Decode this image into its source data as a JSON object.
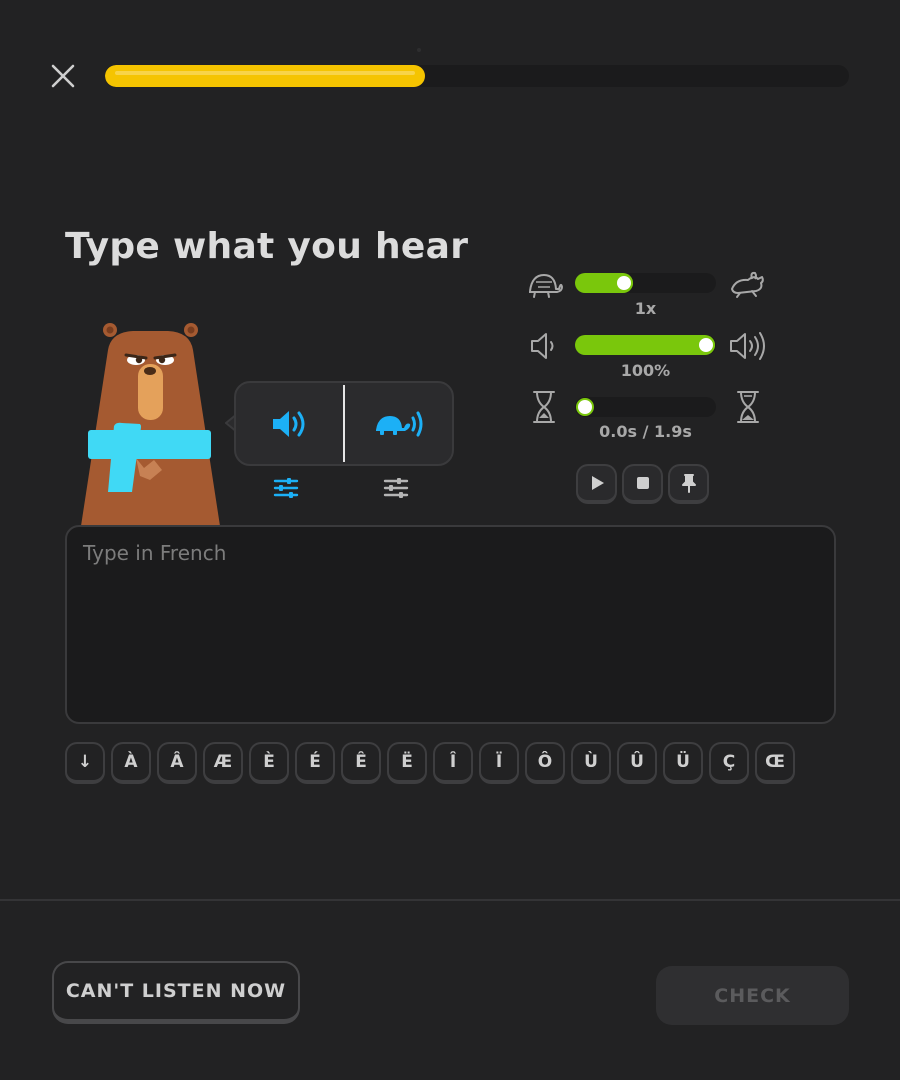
{
  "header": {
    "progress_fraction": 0.43,
    "progress_color": "#f5c400"
  },
  "prompt": {
    "title": "Type what you hear"
  },
  "audio": {
    "normal_button": "speaker-icon",
    "slow_button": "turtle-speaker-icon",
    "accent_color": "#1cb0f6"
  },
  "controls": {
    "speed": {
      "value_label": "1x",
      "fraction": 0.35
    },
    "volume": {
      "value_label": "100%",
      "fraction": 1.0
    },
    "time": {
      "value_label": "0.0s / 1.9s",
      "fraction": 0.0
    },
    "slider_color": "#7ac70c"
  },
  "answer": {
    "placeholder": "Type in French",
    "value": ""
  },
  "special_chars": [
    "↓",
    "À",
    "Â",
    "Æ",
    "È",
    "É",
    "Ê",
    "Ë",
    "Î",
    "Ï",
    "Ô",
    "Ù",
    "Û",
    "Ü",
    "Ç",
    "Œ"
  ],
  "footer": {
    "cant_listen_label": "CAN'T LISTEN NOW",
    "check_label": "CHECK"
  }
}
